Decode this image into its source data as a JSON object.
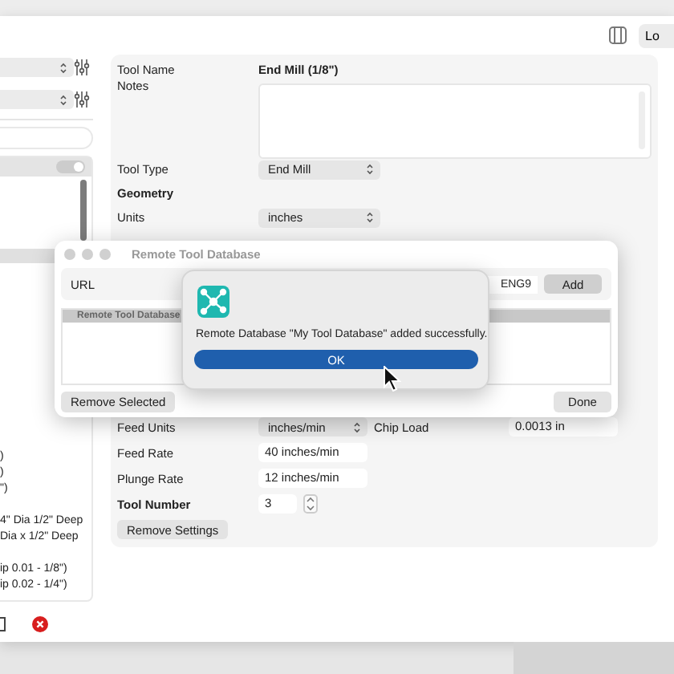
{
  "toolbar": {
    "button": "Lo"
  },
  "library": {
    "toggle_on": true,
    "groups": [
      [
        ")",
        ")",
        "\")"
      ],
      [
        "4\" Dia 1/2\" Deep",
        "Dia x 1/2\" Deep"
      ],
      [
        "ip 0.01 - 1/8\")",
        "ip 0.02 - 1/4\")"
      ]
    ]
  },
  "tool": {
    "fields": [
      {
        "label": "Tool Name",
        "kind": "text",
        "value": "End Mill (1/8\")"
      },
      {
        "label": "Notes",
        "kind": "textarea"
      },
      {
        "label": "Tool Type",
        "kind": "select",
        "value": "End Mill"
      },
      {
        "label": "Geometry",
        "kind": "heading"
      },
      {
        "label": "Units",
        "kind": "select",
        "value": "inches"
      }
    ],
    "feed_fields": [
      {
        "label": "Feed Units",
        "kind": "select",
        "value": "inches/min",
        "extra_label": "Chip Load",
        "extra_value": "0.0013 in"
      },
      {
        "label": "Feed Rate",
        "kind": "input",
        "value": "40 inches/min"
      },
      {
        "label": "Plunge Rate",
        "kind": "input",
        "value": "12 inches/min"
      },
      {
        "label": "Tool Number",
        "kind": "stepper",
        "value": "3"
      }
    ],
    "remove_button": "Remove Settings"
  },
  "dialog": {
    "title": "Remote Tool Database",
    "url_label": "URL",
    "url_value": "ENG9",
    "add_button": "Add",
    "table_header": "Remote Tool Database",
    "remove_button": "Remove Selected",
    "done_button": "Done"
  },
  "alert": {
    "message": "Remote Database \"My Tool Database\" added successfully.",
    "ok_button": "OK"
  }
}
